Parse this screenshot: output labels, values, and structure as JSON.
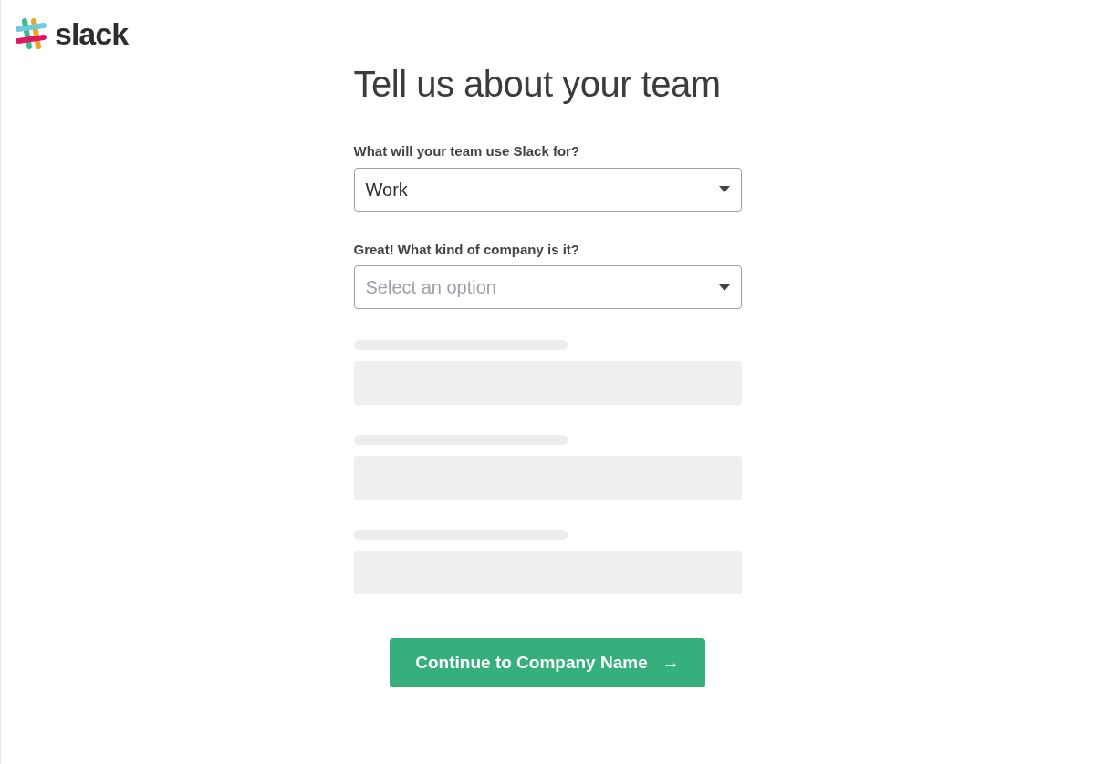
{
  "logo": {
    "text": "slack"
  },
  "title": "Tell us about your team",
  "fields": [
    {
      "label": "What will your team use Slack for?",
      "value": "Work"
    },
    {
      "label": "Great! What kind of company is it?",
      "placeholder": "Select an option"
    }
  ],
  "loading_fields": [
    {
      "kind": "skeleton"
    },
    {
      "kind": "skeleton"
    },
    {
      "kind": "skeleton"
    }
  ],
  "button": {
    "label": "Continue to Company Name",
    "arrow": "→"
  }
}
